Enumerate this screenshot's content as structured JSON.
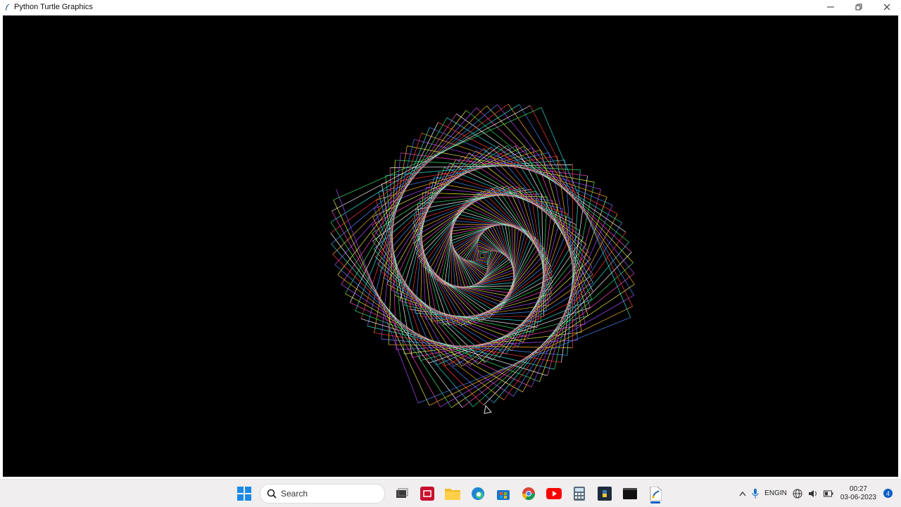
{
  "window": {
    "title": "Python Turtle Graphics",
    "controls": {
      "minimize": "—",
      "maximize": "❐",
      "close": "✕"
    }
  },
  "canvas": {
    "background": "#000000",
    "palette": [
      "#ff3b3b",
      "#ffb22e",
      "#f5f54a",
      "#3ee86a",
      "#33e0e0",
      "#4b8bff",
      "#b24bff",
      "#ff4bc8",
      "#ffffff"
    ]
  },
  "taskbar": {
    "search_label": "Search",
    "apps": [
      "start-icon",
      "file-explorer-alt-icon",
      "app-red-icon",
      "folder-icon",
      "edge-icon",
      "store-icon",
      "chrome-icon",
      "youtube-icon",
      "calculator-icon",
      "python-idle-icon",
      "terminal-icon",
      "turtle-app-icon"
    ],
    "tray": {
      "lang_line1": "ENG",
      "lang_line2": "IN",
      "time": "00:27",
      "date": "03-06-2023",
      "notifications": "4"
    }
  }
}
